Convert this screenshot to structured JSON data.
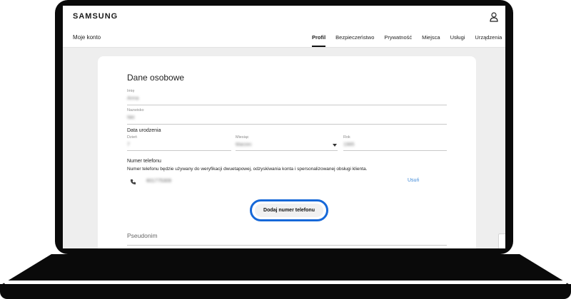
{
  "brand": {
    "logo": "SAMSUNG"
  },
  "header": {
    "account_title": "Moje konto",
    "nav": [
      {
        "label": "Profil",
        "active": true
      },
      {
        "label": "Bezpieczeństwo",
        "active": false
      },
      {
        "label": "Prywatność",
        "active": false
      },
      {
        "label": "Miejsca",
        "active": false
      },
      {
        "label": "Usługi",
        "active": false
      },
      {
        "label": "Urządzenia",
        "active": false
      }
    ]
  },
  "card": {
    "title": "Dane osobowe",
    "first_name": {
      "label": "Imię",
      "value": "Anna"
    },
    "last_name": {
      "label": "Nazwisko",
      "value": "Nkt"
    },
    "birth_date": {
      "label": "Data urodzenia",
      "day": {
        "label": "Dzień",
        "value": "7"
      },
      "month": {
        "label": "Miesiąc",
        "value": "Marzec"
      },
      "year": {
        "label": "Rok",
        "value": "1985"
      }
    },
    "phone": {
      "label": "Numer telefonu",
      "description": "Numer telefonu będzie używany do weryfikacji dwuetapowej, odzyskiwania konta i spersonalizowanej obsługi klienta.",
      "value": "601775309",
      "remove_label": "Usuń"
    },
    "add_phone_button": "Dodaj numer telefonu",
    "nickname": {
      "label": "Pseudonim"
    }
  },
  "colors": {
    "accent": "#1668d8",
    "link": "#3a86d6",
    "frame": "#0a0a0a",
    "screen_bg": "#eeeeee"
  }
}
